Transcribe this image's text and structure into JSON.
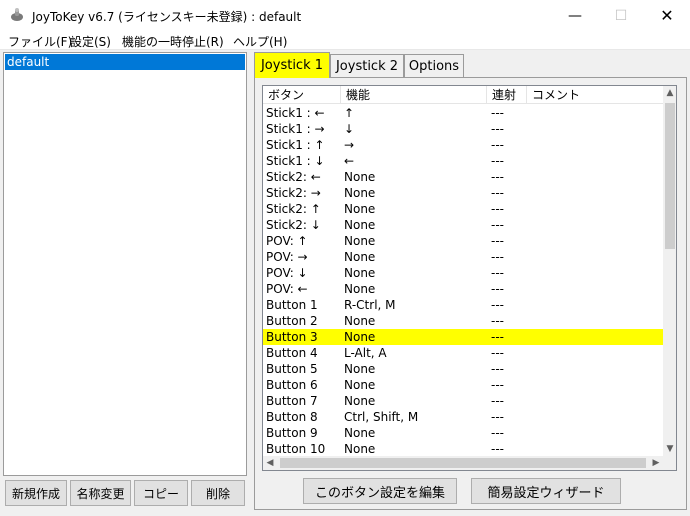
{
  "window": {
    "title": "JoyToKey v6.7 (ライセンスキー未登録) : default",
    "minimize_glyph": "—",
    "maximize_glyph": "☐",
    "close_glyph": "✕"
  },
  "menu": [
    {
      "label": "ファイル(F)"
    },
    {
      "label": "設定(S)"
    },
    {
      "label": "機能の一時停止(R)"
    },
    {
      "label": "ヘルプ(H)"
    }
  ],
  "profiles": {
    "items": [
      {
        "label": "default",
        "selected": true
      }
    ],
    "buttons": {
      "new": "新規作成",
      "rename": "名称変更",
      "copy": "コピー",
      "delete": "削除"
    }
  },
  "tabs": [
    {
      "label": "Joystick 1",
      "active": true
    },
    {
      "label": "Joystick 2",
      "active": false
    },
    {
      "label": "Options",
      "active": false
    }
  ],
  "table": {
    "columns": [
      "ボタン",
      "機能",
      "連射",
      "コメント"
    ],
    "rows": [
      {
        "button": "Stick1 : ←",
        "function": "↑",
        "rapid": "---",
        "comment": ""
      },
      {
        "button": "Stick1 : →",
        "function": "↓",
        "rapid": "---",
        "comment": ""
      },
      {
        "button": "Stick1 : ↑",
        "function": "→",
        "rapid": "---",
        "comment": ""
      },
      {
        "button": "Stick1 : ↓",
        "function": "←",
        "rapid": "---",
        "comment": ""
      },
      {
        "button": "Stick2: ←",
        "function": "None",
        "rapid": "---",
        "comment": ""
      },
      {
        "button": "Stick2: →",
        "function": "None",
        "rapid": "---",
        "comment": ""
      },
      {
        "button": "Stick2: ↑",
        "function": "None",
        "rapid": "---",
        "comment": ""
      },
      {
        "button": "Stick2: ↓",
        "function": "None",
        "rapid": "---",
        "comment": ""
      },
      {
        "button": "POV: ↑",
        "function": "None",
        "rapid": "---",
        "comment": ""
      },
      {
        "button": "POV: →",
        "function": "None",
        "rapid": "---",
        "comment": ""
      },
      {
        "button": "POV: ↓",
        "function": "None",
        "rapid": "---",
        "comment": ""
      },
      {
        "button": "POV: ←",
        "function": "None",
        "rapid": "---",
        "comment": ""
      },
      {
        "button": "Button 1",
        "function": "R-Ctrl, M",
        "rapid": "---",
        "comment": ""
      },
      {
        "button": "Button 2",
        "function": "None",
        "rapid": "---",
        "comment": ""
      },
      {
        "button": "Button 3",
        "function": "None",
        "rapid": "---",
        "comment": "",
        "selected": true
      },
      {
        "button": "Button 4",
        "function": "L-Alt, A",
        "rapid": "---",
        "comment": ""
      },
      {
        "button": "Button 5",
        "function": "None",
        "rapid": "---",
        "comment": ""
      },
      {
        "button": "Button 6",
        "function": "None",
        "rapid": "---",
        "comment": ""
      },
      {
        "button": "Button 7",
        "function": "None",
        "rapid": "---",
        "comment": ""
      },
      {
        "button": "Button 8",
        "function": "Ctrl, Shift, M",
        "rapid": "---",
        "comment": ""
      },
      {
        "button": "Button 9",
        "function": "None",
        "rapid": "---",
        "comment": ""
      },
      {
        "button": "Button 10",
        "function": "None",
        "rapid": "---",
        "comment": ""
      }
    ]
  },
  "scroll": {
    "up": "▲",
    "down": "▼",
    "left": "◀",
    "right": "▶"
  },
  "actions": {
    "edit_button": "このボタン設定を編集",
    "wizard": "簡易設定ウィザード"
  },
  "colors": {
    "selection_blue": "#0078d7",
    "highlight_yellow": "#ffff00"
  }
}
